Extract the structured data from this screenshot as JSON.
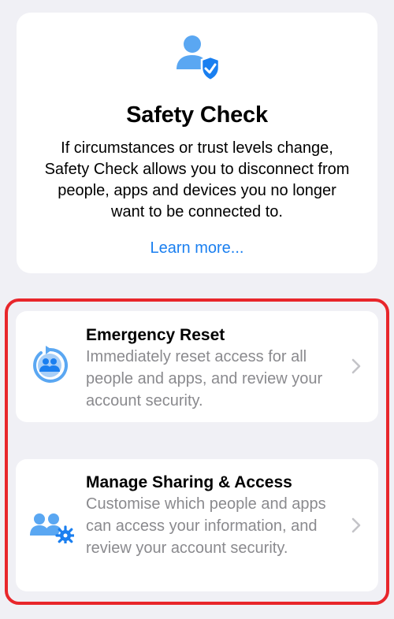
{
  "header": {
    "icon": "person-shield-icon",
    "title": "Safety Check",
    "description": "If circumstances or trust levels change, Safety Check allows you to disconnect from people, apps and devices you no longer want to be connected to.",
    "learn_more": "Learn more..."
  },
  "options": [
    {
      "icon": "reset-people-icon",
      "title": "Emergency Reset",
      "description": "Immediately reset access for all people and apps, and review your account security."
    },
    {
      "icon": "people-gear-icon",
      "title": "Manage Sharing & Access",
      "description": "Customise which people and apps can access your information, and review your account security."
    }
  ],
  "colors": {
    "accent": "#1a7ff0",
    "icon_blue": "#5aa7f2",
    "highlight": "#e8262b",
    "secondary_text": "#8a8a8e",
    "background": "#f0f0f5"
  }
}
